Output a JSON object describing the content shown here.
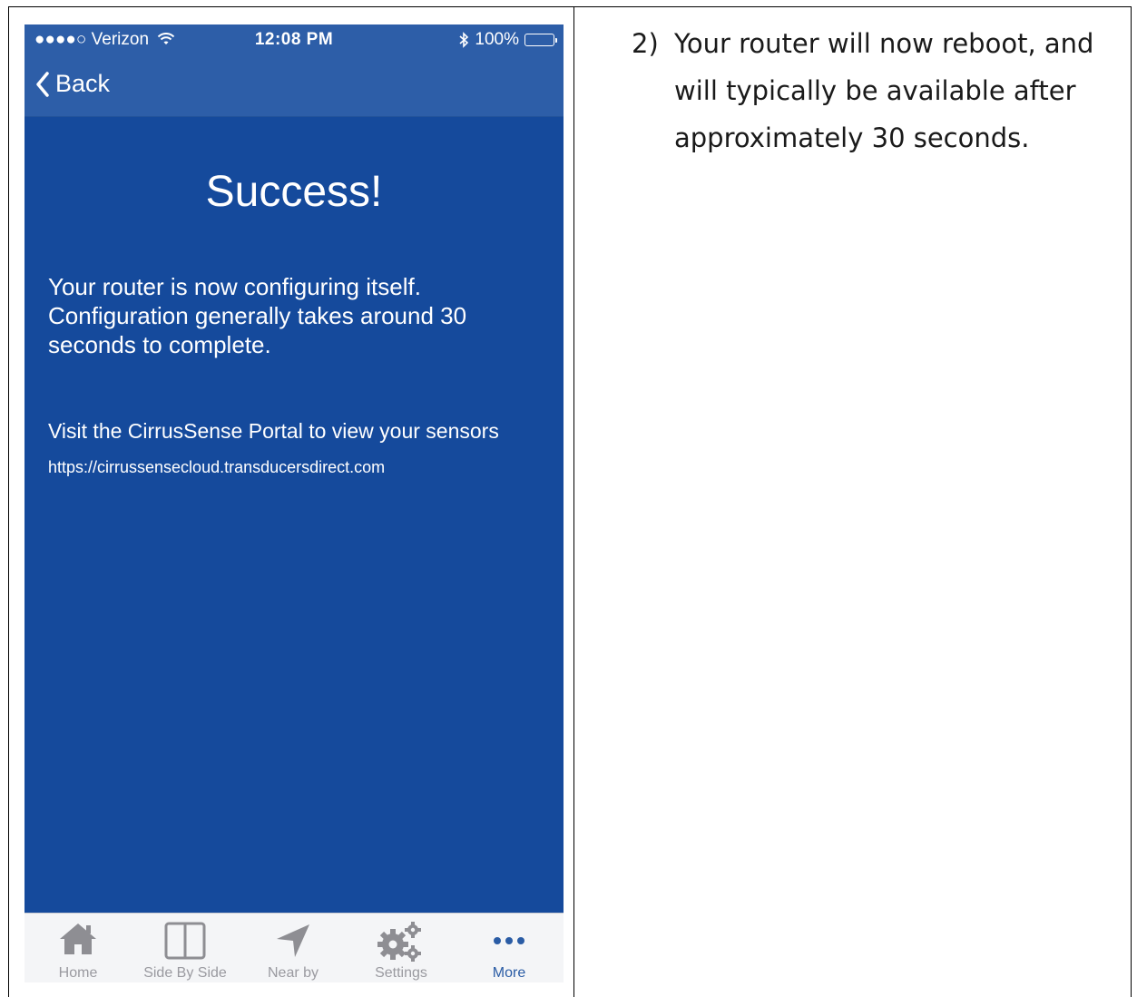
{
  "status_bar": {
    "carrier": "●●●●○ Verizon",
    "time": "12:08 PM",
    "battery": "100%"
  },
  "nav": {
    "back_label": "Back"
  },
  "content": {
    "title": "Success!",
    "message": "Your router is now configuring itself. Configuration generally takes around 30 seconds to complete.",
    "visit_text": "Visit the CirrusSense Portal to view your sensors",
    "url": "https://cirrussensecloud.transducersdirect.com"
  },
  "tabs": [
    {
      "label": "Home",
      "icon": "home-icon"
    },
    {
      "label": "Side By Side",
      "icon": "side-by-side-icon"
    },
    {
      "label": "Near by",
      "icon": "location-arrow-icon"
    },
    {
      "label": "Settings",
      "icon": "gears-icon"
    },
    {
      "label": "More",
      "icon": "more-dots-icon",
      "active": true
    }
  ],
  "colors": {
    "background": "#154a9c",
    "nav_bar": "#2d5ea8",
    "tab_inactive": "#9a9aa0",
    "tab_active": "#2a5ca5"
  },
  "instruction": {
    "number": "2)",
    "text": "Your router will now reboot, and will typically be available after approximately 30 seconds."
  }
}
